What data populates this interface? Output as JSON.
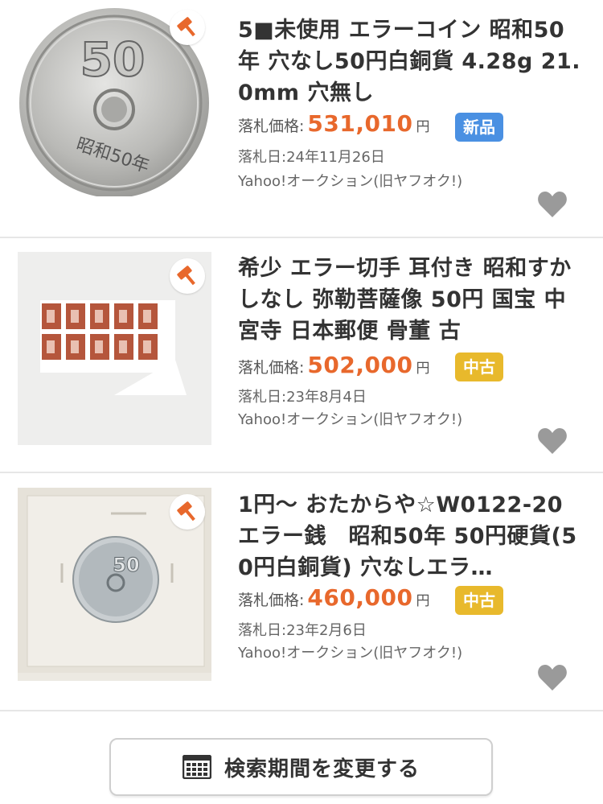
{
  "items": [
    {
      "title": "5■未使用 エラーコイン 昭和50年 穴なし50円白銅貨 4.28g 21.0mm 穴無し",
      "price_label": "落札価格:",
      "price": "531,010",
      "unit": "円",
      "badge": "新品",
      "date": "落札日:24年11月26日",
      "source": "Yahoo!オークション(旧ヤフオク!)",
      "coin_text": "50",
      "coin_era": "昭和50年"
    },
    {
      "title": "希少 エラー切手 耳付き 昭和すかしなし 弥勒菩薩像 50円 国宝 中宮寺 日本郵便 骨董 古",
      "price_label": "落札価格:",
      "price": "502,000",
      "unit": "円",
      "badge": "中古",
      "date": "落札日:23年8月4日",
      "source": "Yahoo!オークション(旧ヤフオク!)"
    },
    {
      "title": "1円〜 おたからや☆W0122-20 エラー銭　昭和50年 50円硬貨(50円白銅貨) 穴なしエラ…",
      "price_label": "落札価格:",
      "price": "460,000",
      "unit": "円",
      "badge": "中古",
      "date": "落札日:23年2月6日",
      "source": "Yahoo!オークション(旧ヤフオク!)"
    }
  ],
  "search_button": {
    "label": "検索期間を変更する",
    "icon": "calendar-icon"
  },
  "colors": {
    "price": "#e8682c",
    "badge_new": "#4a90e2",
    "badge_used": "#e8b92c",
    "heart": "#9a9a9a",
    "hammer": "#e8682c"
  }
}
